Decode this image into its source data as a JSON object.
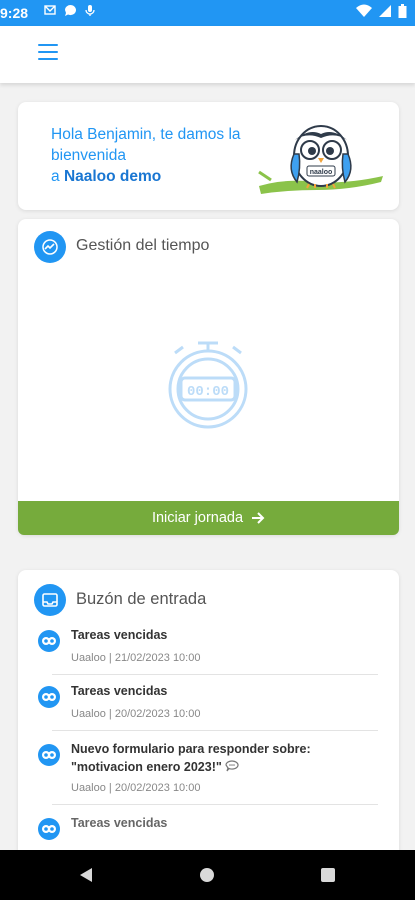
{
  "status_bar": {
    "time": "9:28"
  },
  "welcome": {
    "greeting_line": "Hola Benjamin, te damos la bienvenida",
    "prefix": "a",
    "company": "Naaloo demo"
  },
  "time_card": {
    "title": "Gestión del tiempo",
    "timer_display": "00:00",
    "start_button": "Iniciar jornada"
  },
  "inbox": {
    "title": "Buzón de entrada",
    "messages": [
      {
        "title": "Tareas vencidas",
        "meta": "Uaaloo | 21/02/2023 10:00"
      },
      {
        "title": "Tareas vencidas",
        "meta": "Uaaloo | 20/02/2023 10:00"
      },
      {
        "title": "Nuevo formulario para responder sobre: \"motivacion enero 2023!\"",
        "meta": "Uaaloo | 20/02/2023 10:00"
      },
      {
        "title": "Tareas vencidas",
        "meta": ""
      }
    ]
  },
  "colors": {
    "accent": "#2196f3",
    "button": "#76ab3c"
  },
  "icons": {
    "menu": "hamburger-icon",
    "time_card": "chart-line-icon",
    "inbox": "inbox-icon",
    "message": "owl-icon"
  }
}
